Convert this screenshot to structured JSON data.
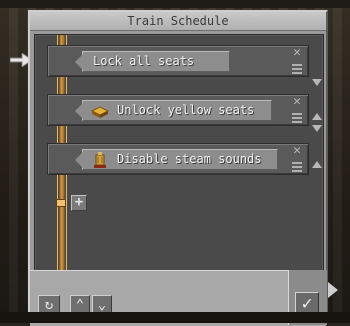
{
  "window": {
    "title": "Train Schedule"
  },
  "schedule": {
    "entries": [
      {
        "label": "Lock all seats",
        "icon": "none",
        "arrows": [
          "down"
        ]
      },
      {
        "label": "Unlock yellow seats",
        "icon": "yellow-seat-icon",
        "arrows": [
          "up",
          "down"
        ]
      },
      {
        "label": "Disable steam sounds",
        "icon": "steam-whistle-icon",
        "arrows": [
          "up"
        ]
      }
    ],
    "add_label": "+",
    "remove_label": "✕"
  },
  "toolbar": {
    "cycle_label": "↻",
    "up_label": "⌃",
    "down_label": "⌄",
    "confirm_label": "✓"
  },
  "colors": {
    "track": "#d19a4a",
    "entry_bg": "#5a5a5a",
    "label_bg": "#8d8d8d",
    "panel_bg": "#4a4a4a"
  }
}
